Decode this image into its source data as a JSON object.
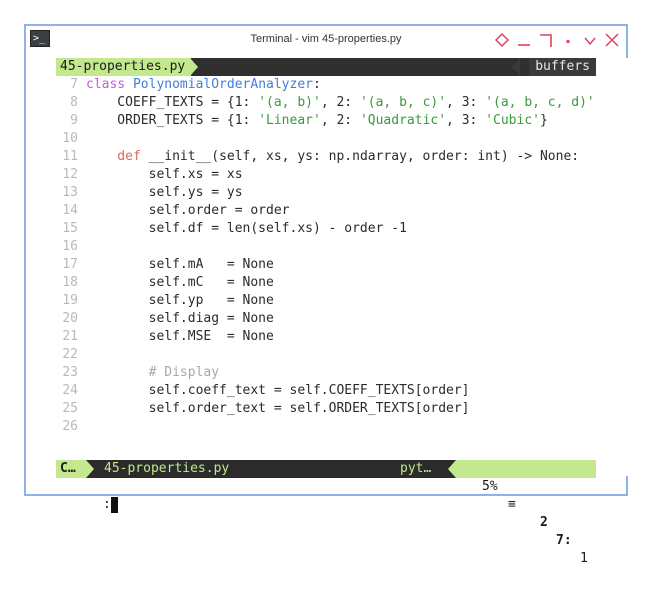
{
  "window": {
    "title": "Terminal - vim 45-properties.py"
  },
  "controls": [
    "diamond-icon",
    "minimize-icon",
    "maximize-icon",
    "dot-icon",
    "chevron-down-icon",
    "close-icon"
  ],
  "tabline": {
    "active_tab": "45-properties.py",
    "buffers_label": "buffers"
  },
  "code": {
    "lines": [
      {
        "n": "7",
        "tokens": [
          [
            "kw",
            "class "
          ],
          [
            "cls",
            "PolynomialOrderAnalyzer"
          ],
          [
            "txt",
            ":"
          ]
        ]
      },
      {
        "n": "8",
        "tokens": [
          [
            "txt",
            "    COEFF_TEXTS = {1: "
          ],
          [
            "str",
            "'(a, b)'"
          ],
          [
            "txt",
            ", 2: "
          ],
          [
            "str",
            "'(a, b, c)'"
          ],
          [
            "txt",
            ", 3: "
          ],
          [
            "str",
            "'(a, b, c, d)'"
          ]
        ]
      },
      {
        "n": "9",
        "tokens": [
          [
            "txt",
            "    ORDER_TEXTS = {1: "
          ],
          [
            "str",
            "'Linear'"
          ],
          [
            "txt",
            ", 2: "
          ],
          [
            "str",
            "'Quadratic'"
          ],
          [
            "txt",
            ", 3: "
          ],
          [
            "str",
            "'Cubic'"
          ],
          [
            "txt",
            "}"
          ]
        ]
      },
      {
        "n": "10",
        "tokens": []
      },
      {
        "n": "11",
        "tokens": [
          [
            "def",
            "    def "
          ],
          [
            "txt",
            "__init__(self, xs, ys: np.ndarray, order: int) -> None:"
          ]
        ]
      },
      {
        "n": "12",
        "tokens": [
          [
            "txt",
            "        self.xs = xs"
          ]
        ]
      },
      {
        "n": "13",
        "tokens": [
          [
            "txt",
            "        self.ys = ys"
          ]
        ]
      },
      {
        "n": "14",
        "tokens": [
          [
            "txt",
            "        self.order = order"
          ]
        ]
      },
      {
        "n": "15",
        "tokens": [
          [
            "txt",
            "        self.df = len(self.xs) - order -1"
          ]
        ]
      },
      {
        "n": "16",
        "tokens": []
      },
      {
        "n": "17",
        "tokens": [
          [
            "txt",
            "        self.mA   = None"
          ]
        ]
      },
      {
        "n": "18",
        "tokens": [
          [
            "txt",
            "        self.mC   = None"
          ]
        ]
      },
      {
        "n": "19",
        "tokens": [
          [
            "txt",
            "        self.yp   = None"
          ]
        ]
      },
      {
        "n": "20",
        "tokens": [
          [
            "txt",
            "        self.diag = None"
          ]
        ]
      },
      {
        "n": "21",
        "tokens": [
          [
            "txt",
            "        self.MSE  = None"
          ]
        ]
      },
      {
        "n": "22",
        "tokens": []
      },
      {
        "n": "23",
        "tokens": [
          [
            "cmt",
            "        # Display"
          ]
        ]
      },
      {
        "n": "24",
        "tokens": [
          [
            "txt",
            "        self.coeff_text = self.COEFF_TEXTS[order]"
          ]
        ]
      },
      {
        "n": "25",
        "tokens": [
          [
            "txt",
            "        self.order_text = self.ORDER_TEXTS[order]"
          ]
        ]
      },
      {
        "n": "26",
        "tokens": []
      }
    ]
  },
  "status": {
    "mode": "C…",
    "filename": "45-properties.py",
    "filetype": "pyt…",
    "percent": "5%",
    "percent_icon": "≡",
    "line": "2",
    "col_sep": "7:",
    "col": "1"
  },
  "cmdline": {
    "prompt": ":"
  },
  "colors": {
    "accent": "#c3e88d",
    "dark": "#2b2b2b",
    "window_border": "#8fb3e6"
  }
}
